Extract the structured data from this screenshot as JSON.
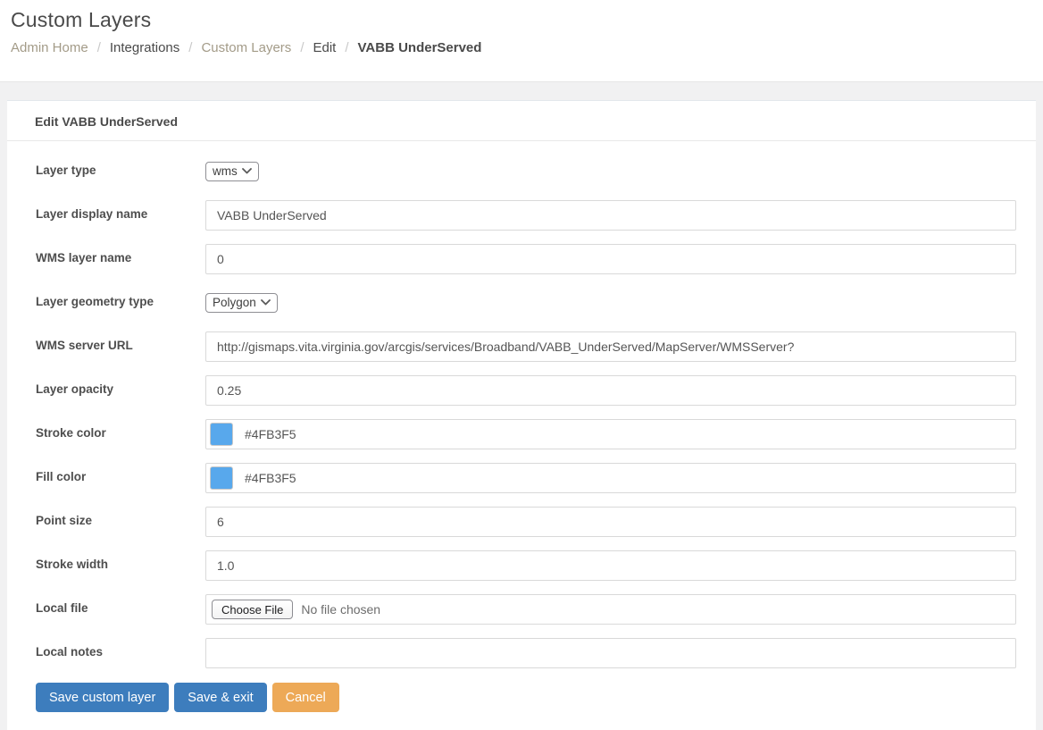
{
  "page": {
    "title": "Custom Layers"
  },
  "breadcrumb": {
    "separator": "/",
    "items": [
      {
        "label": "Admin Home"
      },
      {
        "label": "Integrations"
      },
      {
        "label": "Custom Layers"
      },
      {
        "label": "Edit"
      },
      {
        "label": "VABB UnderServed"
      }
    ]
  },
  "panel": {
    "heading": "Edit VABB UnderServed"
  },
  "form": {
    "fields": [
      {
        "label": "Layer type",
        "type": "select",
        "value": "wms"
      },
      {
        "label": "Layer display name",
        "type": "text",
        "value": "VABB UnderServed"
      },
      {
        "label": "WMS layer name",
        "type": "text",
        "value": "0"
      },
      {
        "label": "Layer geometry type",
        "type": "select",
        "value": "Polygon"
      },
      {
        "label": "WMS server URL",
        "type": "text",
        "value": "http://gismaps.vita.virginia.gov/arcgis/services/Broadband/VABB_UnderServed/MapServer/WMSServer?"
      },
      {
        "label": "Layer opacity",
        "type": "text",
        "value": "0.25"
      },
      {
        "label": "Stroke color",
        "type": "color",
        "value": "#4FB3F5",
        "swatch_color": "#58a8ec"
      },
      {
        "label": "Fill color",
        "type": "color",
        "value": "#4FB3F5",
        "swatch_color": "#58a8ec"
      },
      {
        "label": "Point size",
        "type": "text",
        "value": "6"
      },
      {
        "label": "Stroke width",
        "type": "text",
        "value": "1.0"
      },
      {
        "label": "Local file",
        "type": "file",
        "button_label": "Choose File",
        "status": "No file chosen"
      },
      {
        "label": "Local notes",
        "type": "text",
        "value": ""
      }
    ]
  },
  "actions": {
    "save": "Save custom layer",
    "save_exit": "Save & exit",
    "cancel": "Cancel"
  },
  "colors": {
    "primary_button": "#3d7dbd",
    "cancel_button": "#eda957",
    "breadcrumb_link": "#a39b88",
    "swatch_blue": "#58a8ec",
    "page_background": "#f1f1f2"
  }
}
